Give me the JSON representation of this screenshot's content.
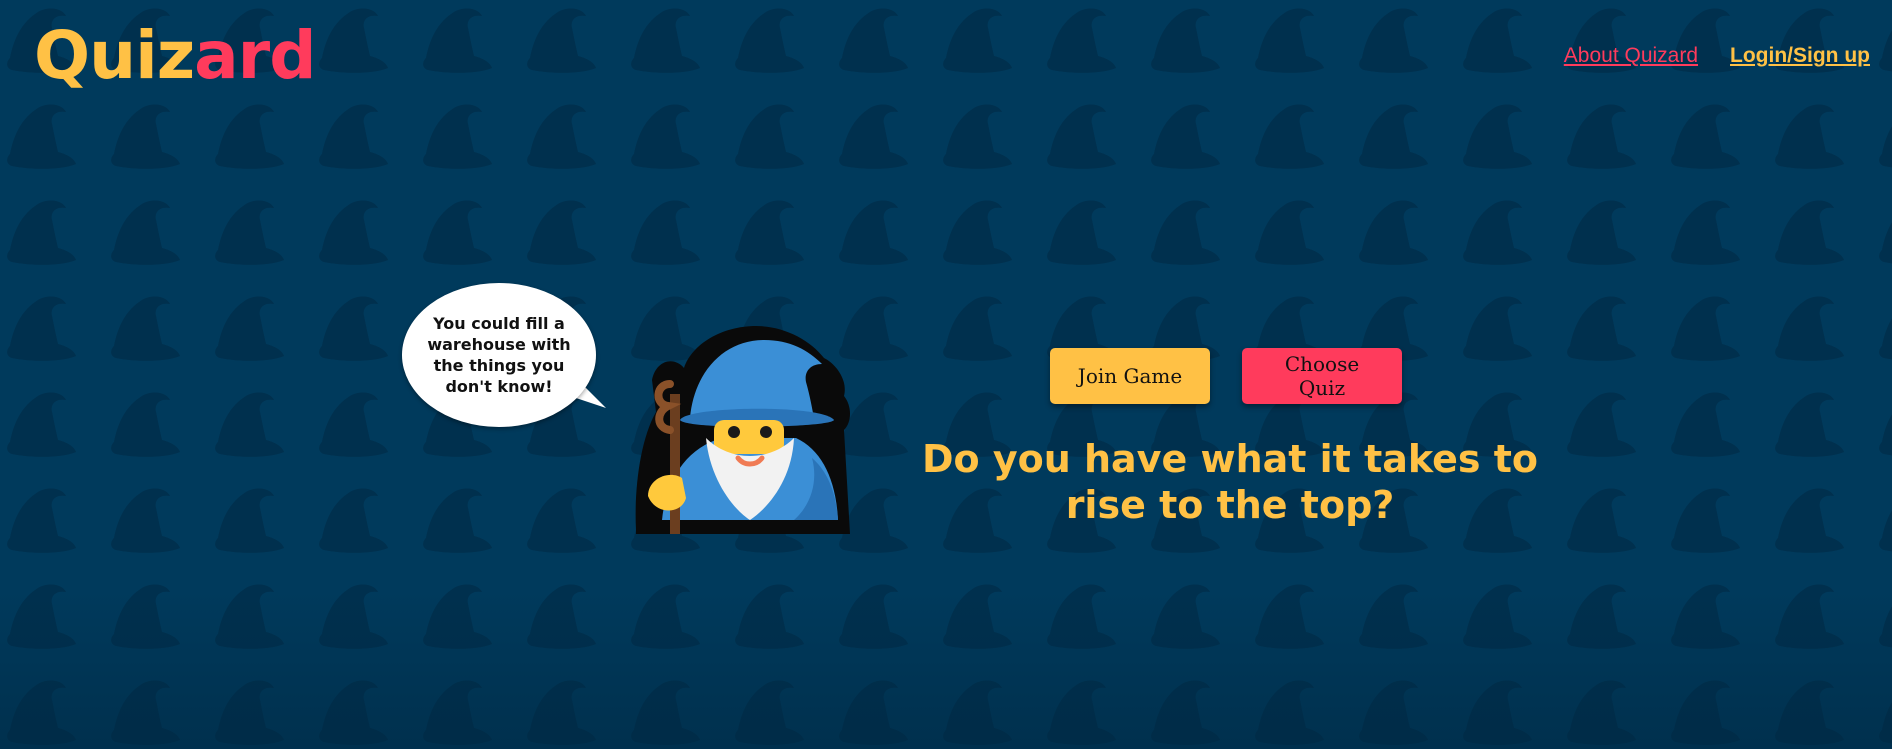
{
  "logo": {
    "part1": "Quiz",
    "part2": "ard"
  },
  "nav": {
    "about": "About Quizard",
    "login": "Login/Sign up"
  },
  "speech_bubble": {
    "text": "You could fill a warehouse with the things you don't know!"
  },
  "buttons": {
    "join_game": "Join Game",
    "choose_quiz": "Choose Quiz"
  },
  "tagline": "Do you have what it takes to rise to the top?",
  "colors": {
    "background": "#003a5c",
    "pattern": "#002f4d",
    "yellow": "#ffc145",
    "pink": "#ff3b5c"
  },
  "icons": {
    "background_pattern": "wizard-hat-icon",
    "mascot": "wizard-mascot-icon"
  }
}
